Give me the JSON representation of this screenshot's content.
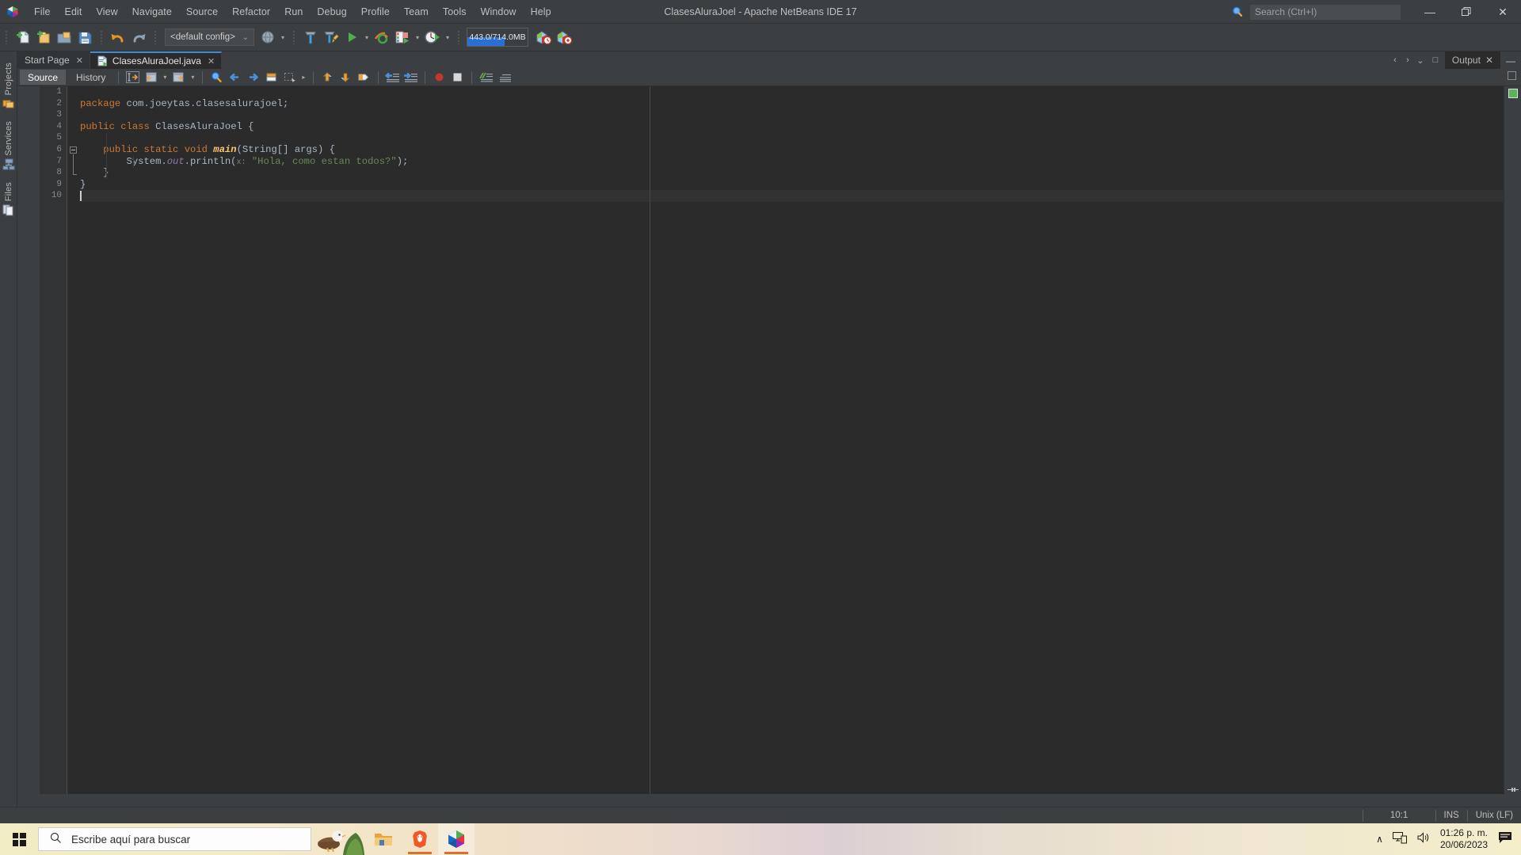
{
  "window": {
    "title": "ClasesAluraJoel - Apache NetBeans IDE 17",
    "logo_icon": "netbeans-logo-icon",
    "minimize_label": "—",
    "maximize_label": "❐",
    "close_label": "✕"
  },
  "menu": {
    "items": [
      {
        "label": "File"
      },
      {
        "label": "Edit"
      },
      {
        "label": "View"
      },
      {
        "label": "Navigate"
      },
      {
        "label": "Source"
      },
      {
        "label": "Refactor"
      },
      {
        "label": "Run"
      },
      {
        "label": "Debug"
      },
      {
        "label": "Profile"
      },
      {
        "label": "Team"
      },
      {
        "label": "Tools"
      },
      {
        "label": "Window"
      },
      {
        "label": "Help"
      }
    ]
  },
  "search": {
    "placeholder": "Search (Ctrl+I)",
    "value": "",
    "icon": "search-magnifier-icon"
  },
  "toolbar": {
    "config_value": "<default config>",
    "config_caret": "⌄",
    "memory": {
      "text": "443.0/714.0MB",
      "used_mb": 443.0,
      "total_mb": 714.0,
      "fill_percent": 62,
      "bar_color": "#2a6fd4"
    },
    "buttons": [
      {
        "name": "new-file-button",
        "icon": "new-file-icon"
      },
      {
        "name": "new-project-button",
        "icon": "new-project-icon"
      },
      {
        "name": "open-project-button",
        "icon": "open-project-icon"
      },
      {
        "name": "save-all-button",
        "icon": "save-all-icon"
      },
      {
        "name": "undo-button",
        "icon": "undo-arrow-icon"
      },
      {
        "name": "redo-button",
        "icon": "redo-arrow-icon"
      },
      {
        "name": "browser-select-button",
        "icon": "globe-icon"
      },
      {
        "name": "build-project-button",
        "icon": "hammer-icon"
      },
      {
        "name": "clean-build-button",
        "icon": "hammer-broom-icon"
      },
      {
        "name": "run-project-button",
        "icon": "play-triangle-icon"
      },
      {
        "name": "debug-project-button",
        "icon": "debug-bug-icon"
      },
      {
        "name": "profile-project-button",
        "icon": "profile-meter-icon"
      },
      {
        "name": "team-pull-button",
        "icon": "gift-clock-icon"
      },
      {
        "name": "team-push-button",
        "icon": "gift-target-icon"
      }
    ]
  },
  "sidebar": {
    "items": [
      {
        "label": "Projects",
        "icon": "projects-folders-icon",
        "name": "sidebar-item-projects"
      },
      {
        "label": "Services",
        "icon": "services-server-icon",
        "name": "sidebar-item-services"
      },
      {
        "label": "Files",
        "icon": "files-pages-icon",
        "name": "sidebar-item-files"
      }
    ]
  },
  "editor_tabs": {
    "tabs": [
      {
        "label": "Start Page",
        "close": "✕",
        "active": false,
        "icon": null
      },
      {
        "label": "ClasesAluraJoel.java",
        "close": "✕",
        "active": true,
        "icon": "java-file-icon"
      }
    ],
    "nav": {
      "prev": "‹",
      "next": "›",
      "dropdown": "⌄",
      "maximize": "□"
    },
    "output_tab": {
      "label": "Output",
      "close": "✕",
      "minimize": "—"
    }
  },
  "source_toolbar": {
    "source_label": "Source",
    "history_label": "History",
    "buttons": [
      {
        "name": "last-edit-button",
        "icon": "last-edit-icon"
      },
      {
        "name": "back-history-button",
        "icon": "back-doc-icon"
      },
      {
        "name": "forward-history-button",
        "icon": "forward-doc-icon"
      },
      {
        "name": "find-selection-button",
        "icon": "find-magnifier-icon"
      },
      {
        "name": "previous-bookmark-button",
        "icon": "left-arrow-icon"
      },
      {
        "name": "next-bookmark-button",
        "icon": "right-arrow-icon"
      },
      {
        "name": "toggle-bookmark-button",
        "icon": "bookmark-icon"
      },
      {
        "name": "rectangular-selection-button",
        "icon": "rect-select-icon"
      },
      {
        "name": "previous-error-button",
        "icon": "up-arrow-icon"
      },
      {
        "name": "next-error-button",
        "icon": "down-arrow-icon"
      },
      {
        "name": "toggle-highlight-button",
        "icon": "highlight-icon"
      },
      {
        "name": "shift-left-button",
        "icon": "shift-left-icon"
      },
      {
        "name": "shift-right-button",
        "icon": "shift-right-icon"
      },
      {
        "name": "toggle-breakpoint-button",
        "icon": "breakpoint-circle-icon"
      },
      {
        "name": "stop-button",
        "icon": "stop-square-icon"
      },
      {
        "name": "comment-button",
        "icon": "comment-icon"
      },
      {
        "name": "uncomment-button",
        "icon": "uncomment-icon"
      }
    ]
  },
  "editor": {
    "language": "java",
    "line_numbers": [
      "1",
      "2",
      "3",
      "4",
      "5",
      "6",
      "7",
      "8",
      "9",
      "10"
    ],
    "caret_line": 10,
    "caret_col": 1,
    "right_margin_col": 80,
    "lines": [
      {
        "n": 1,
        "text": ""
      },
      {
        "n": 2,
        "text": "package com.joeytas.clasesalurajoel;"
      },
      {
        "n": 3,
        "text": ""
      },
      {
        "n": 4,
        "text": "public class ClasesAluraJoel {"
      },
      {
        "n": 5,
        "text": ""
      },
      {
        "n": 6,
        "text": "    public static void main(String[] args) {"
      },
      {
        "n": 7,
        "text": "        System.out.println(x: \"Hola, como estan todos?\");"
      },
      {
        "n": 8,
        "text": "    }"
      },
      {
        "n": 9,
        "text": "}"
      },
      {
        "n": 10,
        "text": ""
      }
    ],
    "tokens": {
      "l2": [
        {
          "t": "package",
          "c": "kw"
        },
        {
          "t": " com.joeytas.clasesalurajoel;",
          "c": "pln"
        }
      ],
      "l4": [
        {
          "t": "public",
          "c": "kw"
        },
        {
          "t": " ",
          "c": "pln"
        },
        {
          "t": "class",
          "c": "kw"
        },
        {
          "t": " ClasesAluraJoel {",
          "c": "pln"
        }
      ],
      "l6": [
        {
          "t": "public",
          "c": "kw"
        },
        {
          "t": " ",
          "c": "pln"
        },
        {
          "t": "static",
          "c": "kw"
        },
        {
          "t": " ",
          "c": "pln"
        },
        {
          "t": "void",
          "c": "kw"
        },
        {
          "t": " ",
          "c": "pln"
        },
        {
          "t": "main",
          "c": "mth"
        },
        {
          "t": "(String[] args) {",
          "c": "pln"
        }
      ],
      "l7": [
        {
          "t": "System.",
          "c": "pln"
        },
        {
          "t": "out",
          "c": "fld"
        },
        {
          "t": ".println(",
          "c": "pln"
        },
        {
          "t": "x:",
          "c": "hint"
        },
        {
          "t": " ",
          "c": "pln"
        },
        {
          "t": "\"Hola, como estan todos?\"",
          "c": "str"
        },
        {
          "t": ");",
          "c": "pln"
        }
      ],
      "l8": [
        {
          "t": "}",
          "c": "pln"
        }
      ],
      "l9": [
        {
          "t": "}",
          "c": "pln"
        }
      ]
    },
    "error_strip": {
      "status": "ok",
      "status_color": "#5ab35a"
    }
  },
  "statusbar": {
    "position": "10:1",
    "insert_mode": "INS",
    "line_ending": "Unix (LF)"
  },
  "taskbar": {
    "start_icon": "windows-logo-icon",
    "search_placeholder": "Escribe aquí para buscar",
    "search_icon": "taskbar-search-icon",
    "apps": [
      {
        "name": "taskbar-file-explorer",
        "icon": "folder-icon",
        "running": false,
        "active": false
      },
      {
        "name": "taskbar-brave-browser",
        "icon": "brave-lion-icon",
        "running": true,
        "active": false
      },
      {
        "name": "taskbar-netbeans",
        "icon": "netbeans-logo-icon",
        "running": true,
        "active": true
      }
    ],
    "tray": {
      "chevron": "∧",
      "network_icon": "network-monitor-icon",
      "volume_icon": "speaker-icon",
      "time": "01:26 p. m.",
      "date": "20/06/2023",
      "notifications_icon": "notifications-icon"
    }
  }
}
